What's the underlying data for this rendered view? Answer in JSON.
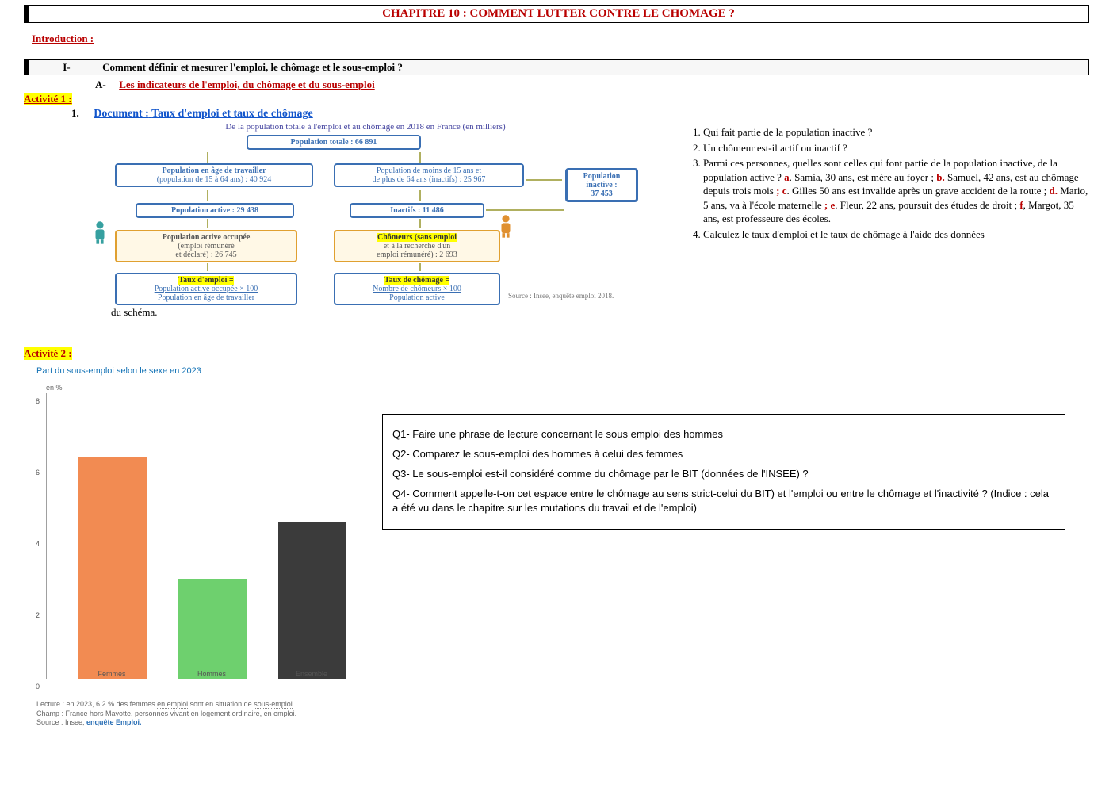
{
  "header": {
    "chapter_title": "CHAPITRE 10 : COMMENT LUTTER CONTRE LE CHOMAGE ?"
  },
  "intro_label": "Introduction :",
  "section_I": {
    "numeral": "I-",
    "title": "Comment définir et mesurer l'emploi, le chômage et le sous-emploi ?",
    "sub_A_label": "A-",
    "sub_A_title": "Les indicateurs de l'emploi, du chômage et du sous-emploi"
  },
  "activite1": {
    "label": "Activité 1 :",
    "doc_num": "1.",
    "doc_label": "Document :",
    "doc_title": "Taux d'emploi et taux de chômage",
    "diagram": {
      "title": "De la population totale à l'emploi et au chômage en 2018 en France (en milliers)",
      "pop_totale": "Population totale : 66 891",
      "pop_age": "Population en âge de travailler",
      "pop_age_detail": "(population de 15 à 64 ans) : 40 924",
      "pop_moins15": "Population de moins de 15 ans et",
      "pop_moins15_b": "de plus de 64 ans (inactifs) : 25 967",
      "pop_active": "Population active : 29 438",
      "inactifs": "Inactifs : 11 486",
      "pop_inactive_box": "Population inactive : 37 453",
      "pao_head": "Population active occupée",
      "pao_l1": "(emploi rémunéré",
      "pao_l2": "et déclaré) : 26 745",
      "chom_head": "Chômeurs (sans emploi",
      "chom_l1": "et à la recherche d'un",
      "chom_l2": "emploi rémunéré) : 2 693",
      "taux_emploi_head": "Taux d'emploi =",
      "taux_emploi_l1": "Population active occupée × 100",
      "taux_emploi_l2": "Population en âge de travailler",
      "taux_chom_head": "Taux de chômage =",
      "taux_chom_l1": "Nombre de chômeurs × 100",
      "taux_chom_l2": "Population active",
      "source": "Source : Insee, enquête emploi 2018."
    },
    "du_schema": "du schéma.",
    "questions": {
      "q1": "Qui fait partie de la population inactive ?",
      "q2": "Un chômeur est-il actif ou inactif ?",
      "q3_lead": "Parmi ces personnes, quelles sont celles qui font partie de la population inactive, de la population active ? ",
      "q3_a": "a",
      "q3_a_txt": ". Samia, 30 ans, est mère au foyer ; ",
      "q3_b": "b.",
      "q3_b_txt": " Samuel, 42 ans, est au chômage depuis trois mois ",
      "q3_c_sep": "; ",
      "q3_c": "c",
      "q3_c_txt": ". Gilles 50 ans est invalide après un grave accident de la route ; ",
      "q3_d": "d.",
      "q3_d_txt": " Mario, 5 ans, va à l'école maternelle ",
      "q3_e_sep": "; ",
      "q3_e": "e",
      "q3_e_txt": ". Fleur, 22 ans, poursuit des études de droit ; ",
      "q3_f": "f",
      "q3_f_txt": ", Margot, 35 ans, est professeure des écoles.",
      "q4": "Calculez le taux d'emploi et le taux de chômage à l'aide des données"
    }
  },
  "activite2": {
    "label": "Activité 2 :",
    "chart_title": "Part du sous-emploi selon le sexe en 2023",
    "y_unit": "en %",
    "foot1a": "Lecture : en 2023, 6,2 % des femmes ",
    "foot1b": "en emploi",
    "foot1c": " sont en situation de ",
    "foot1d": "sous-emploi",
    "foot1e": ".",
    "foot2": "Champ : France hors Mayotte, personnes vivant en logement ordinaire, en emploi.",
    "foot3a": "Source : Insee, ",
    "foot3b": "enquête Emploi.",
    "questions": {
      "q1": "Q1- Faire une phrase de lecture concernant le sous emploi des hommes",
      "q2": "Q2- Comparez le sous-emploi des hommes à celui des femmes",
      "q3": "Q3- Le sous-emploi est-il considéré comme du chômage par le BIT (données de l'INSEE) ?",
      "q4": "Q4- Comment appelle-t-on cet espace entre le chômage au sens strict-celui du BIT) et l'emploi ou entre le chômage et l'inactivité ? (Indice : cela a été vu dans le chapitre sur les mutations du travail et de l'emploi)"
    }
  },
  "chart_data": {
    "type": "bar",
    "title": "Part du sous-emploi selon le sexe en 2023",
    "ylabel": "en %",
    "ylim": [
      0,
      8
    ],
    "yticks": [
      0,
      2,
      4,
      6,
      8
    ],
    "categories": [
      "Femmes",
      "Hommes",
      "Ensemble"
    ],
    "values": [
      6.2,
      2.8,
      4.4
    ],
    "colors": [
      "#f28b52",
      "#6ed06e",
      "#3b3b3b"
    ]
  }
}
